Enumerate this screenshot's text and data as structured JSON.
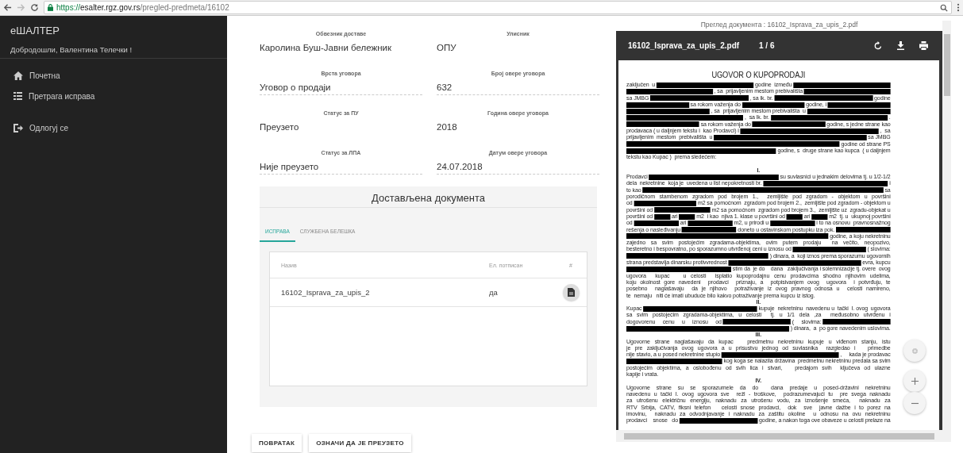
{
  "browser": {
    "address": {
      "scheme": "https://",
      "host": "esalter.rgz.gov.rs",
      "path": "/pregled-predmeta/16102"
    }
  },
  "sidebar": {
    "brand": "еШАЛТЕР",
    "welcome": "Добродошли, Валентина Телечки !",
    "items": [
      {
        "kind": "home",
        "label": "Почетна"
      },
      {
        "kind": "list",
        "label": "Претрага исправа"
      },
      {
        "kind": "logout",
        "label": "Одлогуј се"
      }
    ]
  },
  "fields": [
    {
      "label": "Обвезник доставе",
      "value": "Каролина Буш-Јавни бележник",
      "underlined": false
    },
    {
      "label": "Улисник",
      "value": "ОПУ",
      "underlined": false
    },
    {
      "label": "Врста уговора",
      "value": "Уговор о продаји",
      "underlined": true
    },
    {
      "label": "Број овере уговора",
      "value": "632",
      "underlined": true
    },
    {
      "label": "Статус за ПУ",
      "value": "Преузето",
      "underlined": false
    },
    {
      "label": "Година овере уговора",
      "value": "2018",
      "underlined": false
    },
    {
      "label": "Статус за ЛПА",
      "value": "Није преузето",
      "underlined": true
    },
    {
      "label": "Датум овере уговора",
      "value": "24.07.2018",
      "underlined": true
    }
  ],
  "documents": {
    "title": "Достављена документа",
    "tabs": [
      {
        "label": "ИСПРАВА",
        "selected": true
      },
      {
        "label": "СЛУЖБЕНА БЕЛЕШКА",
        "selected": false
      }
    ],
    "columns": [
      "Назив",
      "Ел. потписан",
      "#"
    ],
    "rows": [
      {
        "name": "16102_Isprava_za_upis_2",
        "signed": "да"
      }
    ]
  },
  "buttons": [
    "ПОВРАТАК",
    "ОЗНАЧИ ДА ЈЕ ПРЕУЗЕТО"
  ],
  "preview": {
    "caption": "Преглед документа : 16102_Isprava_za_upis_2.pdf",
    "file": "16102_Isprava_za_upis_2.pdf",
    "page": "1 / 6",
    "title": "UGOVOR  O  KUPOPRODAJI",
    "lines": [
      {
        "kind": "justify",
        "parts": [
          "zaključen  u",
          {
            "kind": "redaction"
          },
          "godine  između",
          {
            "kind": "redaction"
          }
        ]
      },
      {
        "kind": "justify",
        "parts": [
          {
            "kind": "redaction"
          },
          ", sa  prijavljenim mestom prebivališta",
          {
            "kind": "redaction"
          }
        ]
      },
      {
        "kind": "justify",
        "parts": [
          "sa JMBG",
          {
            "kind": "redaction"
          },
          ", sa lk. br.",
          {
            "kind": "redaction"
          },
          "godine"
        ]
      },
      {
        "kind": "justify",
        "parts": [
          {
            "kind": "redaction"
          },
          "sa rokom važenja do",
          {
            "kind": "redaction"
          },
          "godine, i",
          {
            "kind": "redaction"
          }
        ]
      },
      {
        "kind": "justify",
        "parts": [
          {
            "kind": "redaction"
          },
          ", sa  prijavljenim mestom prebivališta  u",
          {
            "kind": "redaction"
          }
        ]
      },
      {
        "kind": "justify",
        "parts": [
          {
            "kind": "redaction"
          },
          ",  sa lk. br.",
          {
            "kind": "redaction"
          },
          "."
        ]
      },
      {
        "kind": "justify",
        "parts": [
          {
            "kind": "redaction"
          },
          "sa rokom važenja do",
          {
            "kind": "redaction"
          },
          "godine, s jedne strane kao"
        ]
      },
      {
        "kind": "justify",
        "parts": [
          "prodavaca ( u daljnjem tekstu i  kao Prodavci) i",
          {
            "kind": "redaction"
          },
          ",  sa"
        ]
      },
      {
        "kind": "justify",
        "parts": [
          "prijavljenim  mestom  prebivališta  u",
          {
            "kind": "redaction"
          },
          "sa JMBG"
        ]
      },
      {
        "kind": "justify",
        "parts": [
          {
            "kind": "redaction"
          },
          "godine od strane PS"
        ]
      },
      {
        "kind": "justify",
        "parts": [
          {
            "kind": "redaction"
          },
          "godine, s  druge strane kao kupca  ( u daljnjem"
        ]
      },
      {
        "kind": "left",
        "parts": [
          "tekstu kao Kupac )  prema sledećem:"
        ]
      },
      {
        "kind": "gap"
      },
      {
        "kind": "center",
        "parts": [
          "I."
        ]
      },
      {
        "kind": "justify",
        "parts": [
          "Prodavci",
          {
            "kind": "redaction"
          },
          "su suvlasnici u jednakim delovima tj. u 1/2-1/2"
        ]
      },
      {
        "kind": "justify",
        "parts": [
          "dela  nekretnine  koja je  uvedena u list nepokretnosti br.",
          {
            "kind": "redaction"
          },
          "i"
        ]
      },
      {
        "kind": "justify",
        "parts": [
          "to kao",
          {
            "kind": "redaction"
          },
          "sa"
        ]
      },
      {
        "kind": "justify",
        "parts": [
          "porodičnom stambenom zgradom pod brojem 1.,  zemljište pod zgradom - objektom u površini"
        ]
      },
      {
        "kind": "justify",
        "parts": [
          "od",
          {
            "kind": "redaction"
          },
          "m2 sa pomoćnom  zgradom pod brojem 2.,  zemljište pod zgradom - objektom u"
        ]
      },
      {
        "kind": "justify",
        "parts": [
          "površini od",
          {
            "kind": "redaction"
          },
          "m2 sa pomoćnom  zgradom pod brojem 3.,  zemljište uz  zgradu-objekat u"
        ]
      },
      {
        "kind": "justify",
        "parts": [
          "površini od",
          {
            "kind": "redaction"
          },
          "ari",
          {
            "kind": "redaction"
          },
          "m2  i kao  njiva 1. klase u površini od",
          {
            "kind": "redaction"
          },
          "ari",
          {
            "kind": "redaction"
          },
          "m2  tj. u  ukupnoj površini"
        ]
      },
      {
        "kind": "justify",
        "parts": [
          "od",
          {
            "kind": "redaction"
          },
          "ari",
          {
            "kind": "redaction"
          },
          "m2, u prirodi u",
          {
            "kind": "redaction"
          },
          "i to na osnovu  pravnosnažnog"
        ]
      },
      {
        "kind": "justify",
        "parts": [
          "rešenja o nasleđivanju",
          {
            "kind": "redaction"
          },
          "doneto u ostavinskom postupku iza pok.",
          {
            "kind": "redaction"
          }
        ]
      },
      {
        "kind": "justify",
        "parts": [
          {
            "kind": "redaction"
          },
          "godine, a koju nekretninu"
        ]
      },
      {
        "kind": "justify",
        "parts": [
          "zajedno sa svim postojećim zgradama-objektima, ovim putem prodaju  na večito, neopozivo,"
        ]
      },
      {
        "kind": "justify",
        "parts": [
          "besteretno i bespovratno, po sporazumno utvrđenoj ceni u iznosu od",
          {
            "kind": "redaction"
          },
          "( slovima:"
        ]
      },
      {
        "kind": "justify",
        "parts": [
          {
            "kind": "redaction"
          },
          ") dinara, a  koji iznos prema sporazumu ugovornih"
        ]
      },
      {
        "kind": "justify",
        "parts": [
          "strana predstavlja dinarsku protivvrednost",
          {
            "kind": "redaction"
          },
          "evra, kupcu"
        ]
      },
      {
        "kind": "justify",
        "parts": [
          {
            "kind": "redaction"
          },
          "stim da  je do    dana   zaključivanja i solemnizacije tj. overe  ovog"
        ]
      },
      {
        "kind": "justify",
        "parts": [
          "ugovora  kupac   u celosti  isplatio kupoprodajnu cenu prodavcima shodno njihovim udelima,"
        ]
      },
      {
        "kind": "justify",
        "parts": [
          "koju okolnost gore navedeni  prodavci  priznaju, a  potpisivanjem ovog  ugovora  i potvrđuju, te"
        ]
      },
      {
        "kind": "justify",
        "parts": [
          "posebno  naglašavaju  da je njihovo  potraživanje iz ovog pravnog odnosa u  celosti namireno,"
        ]
      },
      {
        "kind": "left",
        "parts": [
          "te  nemaju   niti će imati ubuduće bilo kakvo potraživanje prema kupcu iz istog."
        ]
      },
      {
        "kind": "center",
        "parts": [
          "II."
        ]
      },
      {
        "kind": "justify",
        "parts": [
          "Kupac",
          {
            "kind": "redaction"
          },
          "kupuje  nekretninu  navedenu u  tački  I. ovog  ugovora"
        ]
      },
      {
        "kind": "justify",
        "parts": [
          "sa svim postojećim zgradama-objektima, u celosti  tj. u 1/1 dela ,za  međusobno utvrđenu i"
        ]
      },
      {
        "kind": "justify",
        "parts": [
          "dogovorenu     cenu     u     iznosu     od",
          {
            "kind": "redaction"
          },
          "(     slovima:",
          {
            "kind": "redaction"
          }
        ]
      },
      {
        "kind": "left",
        "parts": [
          {
            "kind": "redaction"
          },
          ") dinara,  a  po gore navedenim uslovima."
        ]
      },
      {
        "kind": "center",
        "parts": [
          "III."
        ]
      },
      {
        "kind": "justify",
        "parts": [
          "Ugovorne strane naglašavaju da kupac   predmetnu nekretninu kupuje u viđenom stanju, istu"
        ]
      },
      {
        "kind": "justify",
        "parts": [
          "je pre zaključivanja ovog ugovora a u prisustvu jednog od suvlasnika  razgledao i   primedbe"
        ]
      },
      {
        "kind": "justify",
        "parts": [
          "nije stavio, a u posed nekretnine stupio",
          {
            "kind": "redaction"
          },
          ",     kada je prodavac"
        ]
      },
      {
        "kind": "justify",
        "parts": [
          {
            "kind": "redaction"
          },
          "kog koga se nalazila državina  predmetnu nekretninu predala sa svim"
        ]
      },
      {
        "kind": "justify",
        "parts": [
          "postojećim objektima, a oslobođenu od svih lica i stvari,   predajom svih  ključeva od ulazne"
        ]
      },
      {
        "kind": "left",
        "parts": [
          "kapije i vrata."
        ]
      },
      {
        "kind": "center",
        "parts": [
          "IV."
        ]
      },
      {
        "kind": "justify",
        "parts": [
          "Ugovorne strane su se sporazumele da do  dana predaje u posed-državini nekretninu"
        ]
      },
      {
        "kind": "justify",
        "parts": [
          "navedenu u tački I. ovog ugovora sve  režl - troškove,  podrazumevajući tu  pre svega naknadu"
        ]
      },
      {
        "kind": "justify",
        "parts": [
          "za utrošenu električnu energiju, naknadu za utrošenu vodu, za iznošenje smeća,  naknadu za"
        ]
      },
      {
        "kind": "justify",
        "parts": [
          "RTV Srbija, CATV, fiksni telefon   celosti snose prodavci,  dok  sve  javne dažbe i to porez na"
        ]
      },
      {
        "kind": "justify",
        "parts": [
          "imovinu,  naknadu za odvodnjavanje i naknadu za zaštitu okoline  u odnosu na ovu nekretninu"
        ]
      },
      {
        "kind": "justify",
        "parts": [
          "prodavci    snose   do",
          {
            "kind": "redaction"
          },
          "godine, a nakon toga ove obaveze u celosti prelaze na"
        ]
      }
    ]
  }
}
